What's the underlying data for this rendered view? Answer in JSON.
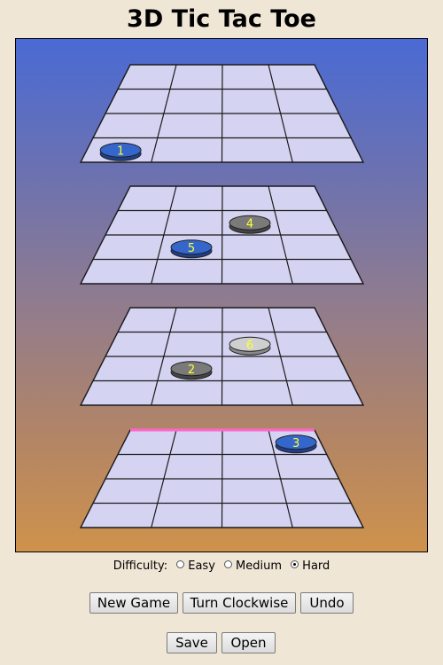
{
  "title": "3D Tic Tac Toe",
  "colors": {
    "grid_fill": "#d5d3f2",
    "grid_line": "#1a1a1a",
    "blue_piece": "#3566cc",
    "dark_gray_piece": "#7a7a7a",
    "light_gray_piece": "#cfcfcf",
    "number_text": "#ffff33",
    "win_line": "#ff66cc"
  },
  "board": {
    "levels": 4,
    "grid_size": 4,
    "pieces": [
      {
        "number": "1",
        "level": 0,
        "row": 3,
        "col": 0,
        "color": "blue"
      },
      {
        "number": "4",
        "level": 1,
        "row": 1,
        "col": 2,
        "color": "dark_gray"
      },
      {
        "number": "5",
        "level": 1,
        "row": 2,
        "col": 1,
        "color": "blue"
      },
      {
        "number": "6",
        "level": 2,
        "row": 1,
        "col": 2,
        "color": "light_gray"
      },
      {
        "number": "2",
        "level": 2,
        "row": 2,
        "col": 1,
        "color": "dark_gray"
      },
      {
        "number": "3",
        "level": 3,
        "row": 0,
        "col": 3,
        "color": "blue"
      }
    ],
    "highlight": {
      "level": 3,
      "edge": "top"
    }
  },
  "difficulty": {
    "label": "Difficulty:",
    "options": [
      {
        "label": "Easy",
        "checked": false
      },
      {
        "label": "Medium",
        "checked": false
      },
      {
        "label": "Hard",
        "checked": true
      }
    ]
  },
  "buttons": {
    "new_game": "New Game",
    "turn_clockwise": "Turn Clockwise",
    "undo": "Undo",
    "save": "Save",
    "open": "Open"
  }
}
